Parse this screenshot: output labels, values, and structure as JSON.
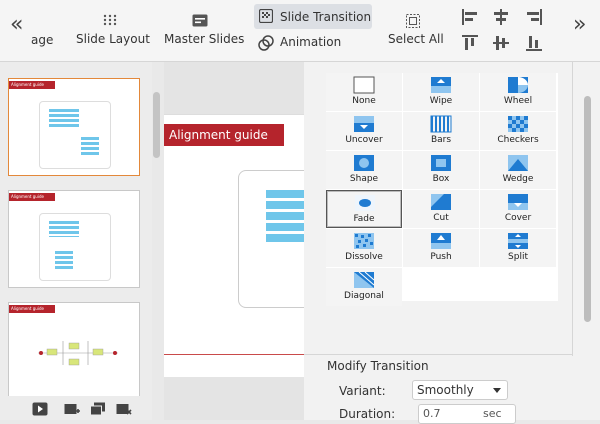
{
  "toolbar": {
    "collapse_left": "«",
    "collapse_right": "»",
    "partial_label": "age",
    "slide_layout": "Slide Layout",
    "master_slides": "Master Slides",
    "slide_transition": "Slide Transition",
    "animation": "Animation",
    "select_all": "Select All"
  },
  "slides": [
    {
      "tag": "Alignment guide",
      "selected": true
    },
    {
      "tag": "Alignment guide",
      "selected": false
    },
    {
      "tag": "Alignment guide",
      "selected": false
    }
  ],
  "canvas": {
    "banner": "Alignment guide"
  },
  "transitions": [
    {
      "label": "None",
      "icon": "none-icon"
    },
    {
      "label": "Wipe",
      "icon": "wipe-icon"
    },
    {
      "label": "Wheel",
      "icon": "wheel-icon"
    },
    {
      "label": "Uncover",
      "icon": "uncover-icon"
    },
    {
      "label": "Bars",
      "icon": "bars-icon"
    },
    {
      "label": "Checkers",
      "icon": "checkers-icon"
    },
    {
      "label": "Shape",
      "icon": "shape-icon"
    },
    {
      "label": "Box",
      "icon": "box-icon"
    },
    {
      "label": "Wedge",
      "icon": "wedge-icon"
    },
    {
      "label": "Fade",
      "icon": "fade-icon",
      "selected": true
    },
    {
      "label": "Cut",
      "icon": "cut-icon"
    },
    {
      "label": "Cover",
      "icon": "cover-icon"
    },
    {
      "label": "Dissolve",
      "icon": "dissolve-icon"
    },
    {
      "label": "Push",
      "icon": "push-icon"
    },
    {
      "label": "Split",
      "icon": "split-icon"
    },
    {
      "label": "Diagonal",
      "icon": "diagonal-icon"
    }
  ],
  "modify": {
    "title": "Modify Transition",
    "variant_label": "Variant:",
    "variant_value": "Smoothly",
    "duration_label": "Duration:",
    "duration_value": "0.7",
    "duration_unit": "sec"
  },
  "colors": {
    "accent_red": "#b5242c",
    "icon_blue": "#1f7bd1",
    "selected_orange": "#e3883a"
  }
}
